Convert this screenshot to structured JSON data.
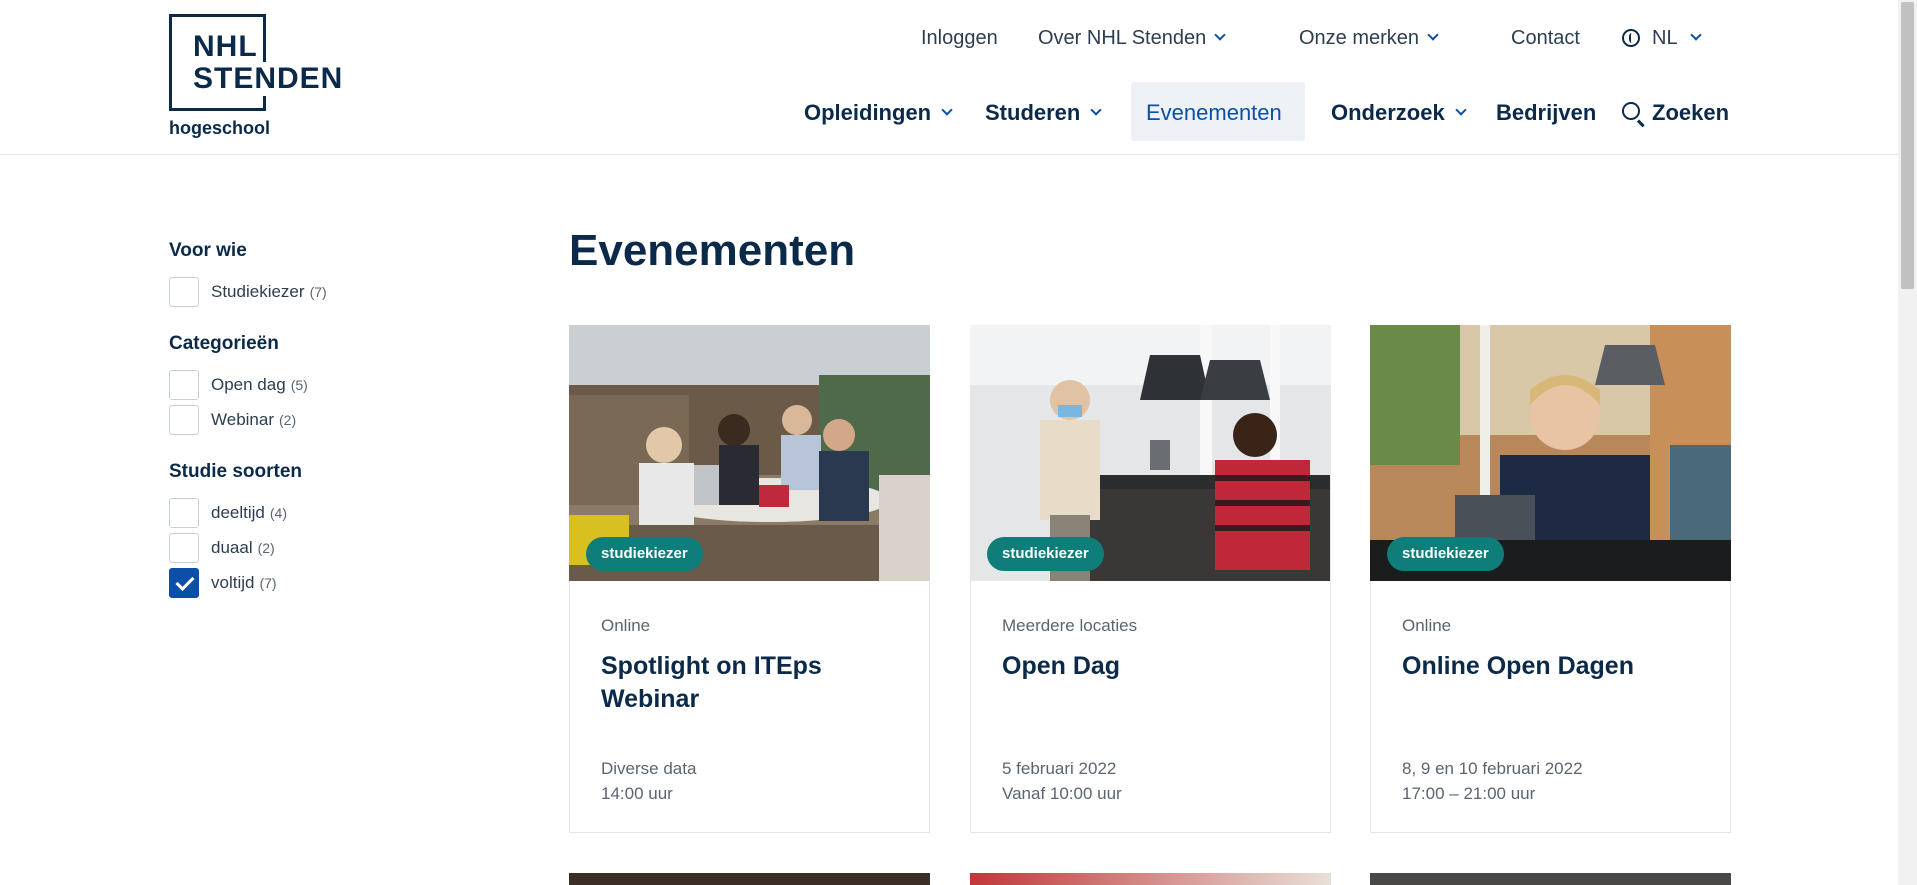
{
  "logo": {
    "line1": "NHL",
    "line2": "STENDEN",
    "sub": "hogeschool"
  },
  "topnav": {
    "login": "Inloggen",
    "about": "Over NHL Stenden",
    "brands": "Onze merken",
    "contact": "Contact",
    "language": "NL"
  },
  "mainnav": {
    "programs": "Opleidingen",
    "study": "Studeren",
    "events": "Evenementen",
    "research": "Onderzoek",
    "companies": "Bedrijven",
    "search": "Zoeken"
  },
  "filters": {
    "groups": [
      {
        "heading": "Voor wie",
        "items": [
          {
            "label": "Studiekiezer",
            "count": "(7)",
            "checked": false
          }
        ]
      },
      {
        "heading": "Categorieën",
        "items": [
          {
            "label": "Open dag",
            "count": "(5)",
            "checked": false
          },
          {
            "label": "Webinar",
            "count": "(2)",
            "checked": false
          }
        ]
      },
      {
        "heading": "Studie soorten",
        "items": [
          {
            "label": "deeltijd",
            "count": "(4)",
            "checked": false
          },
          {
            "label": "duaal",
            "count": "(2)",
            "checked": false
          },
          {
            "label": "voltijd",
            "count": "(7)",
            "checked": true
          }
        ]
      }
    ]
  },
  "page": {
    "title": "Evenementen"
  },
  "cards": [
    {
      "tag": "studiekiezer",
      "location": "Online",
      "title": "Spotlight on ITEps Webinar",
      "date_line1": "Diverse data",
      "date_line2": "14:00 uur"
    },
    {
      "tag": "studiekiezer",
      "location": "Meerdere locaties",
      "title": "Open Dag",
      "date_line1": "5 februari 2022",
      "date_line2": "Vanaf 10:00 uur"
    },
    {
      "tag": "studiekiezer",
      "location": "Online",
      "title": "Online Open Dagen",
      "date_line1": "8, 9 en 10 februari 2022",
      "date_line2": "17:00 – 21:00 uur"
    }
  ],
  "colors": {
    "navy": "#0b2a4a",
    "accent_blue": "#0b4fa8",
    "tag_teal": "#0f7d7a"
  },
  "icons": {
    "dropdown": "chevron-down-icon",
    "language": "globe-icon",
    "search": "search-icon",
    "checked": "checkmark-icon"
  }
}
